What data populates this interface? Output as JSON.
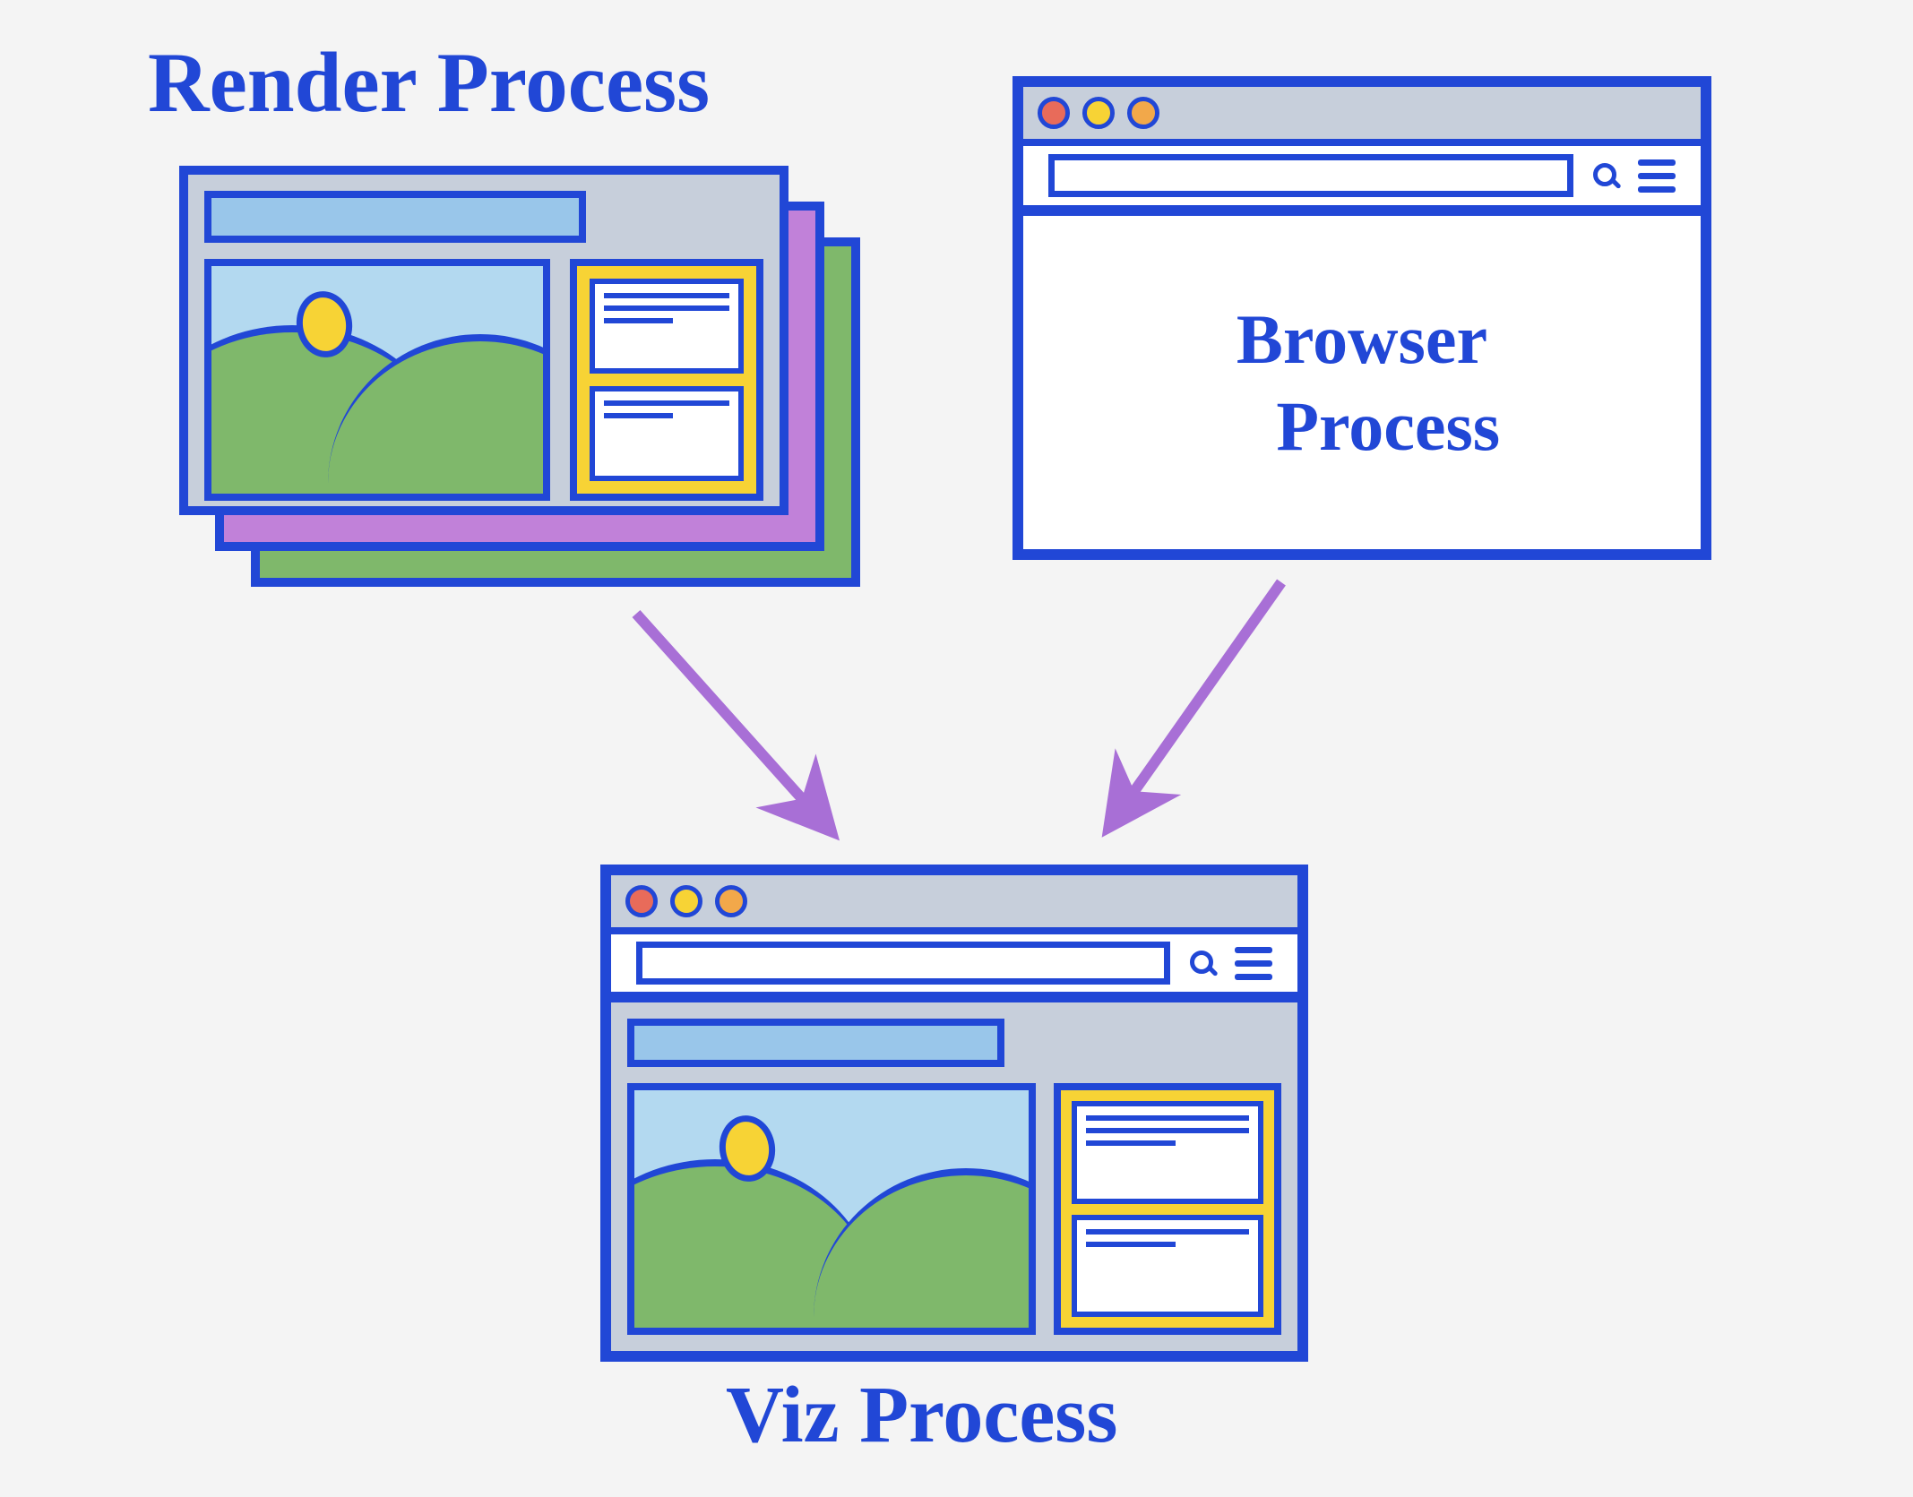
{
  "labels": {
    "render": "Render Process",
    "browser": "Browser\n   Process",
    "viz": "Viz Process"
  },
  "diagram": {
    "nodes": [
      {
        "id": "render",
        "label": "Render Process",
        "role": "multiple stacked web-content render processes"
      },
      {
        "id": "browser",
        "label": "Browser Process",
        "role": "browser chrome / UI process"
      },
      {
        "id": "viz",
        "label": "Viz Process",
        "role": "compositor/display process combining chrome + content"
      }
    ],
    "edges": [
      {
        "from": "render",
        "to": "viz"
      },
      {
        "from": "browser",
        "to": "viz"
      }
    ]
  },
  "colors": {
    "stroke": "#2147d6",
    "arrow": "#a86fd6",
    "green": "#7fb86b",
    "yellow": "#f7d335",
    "sky": "#b3d9f0",
    "grey": "#c7cfdb",
    "pink": "#c181d9"
  }
}
